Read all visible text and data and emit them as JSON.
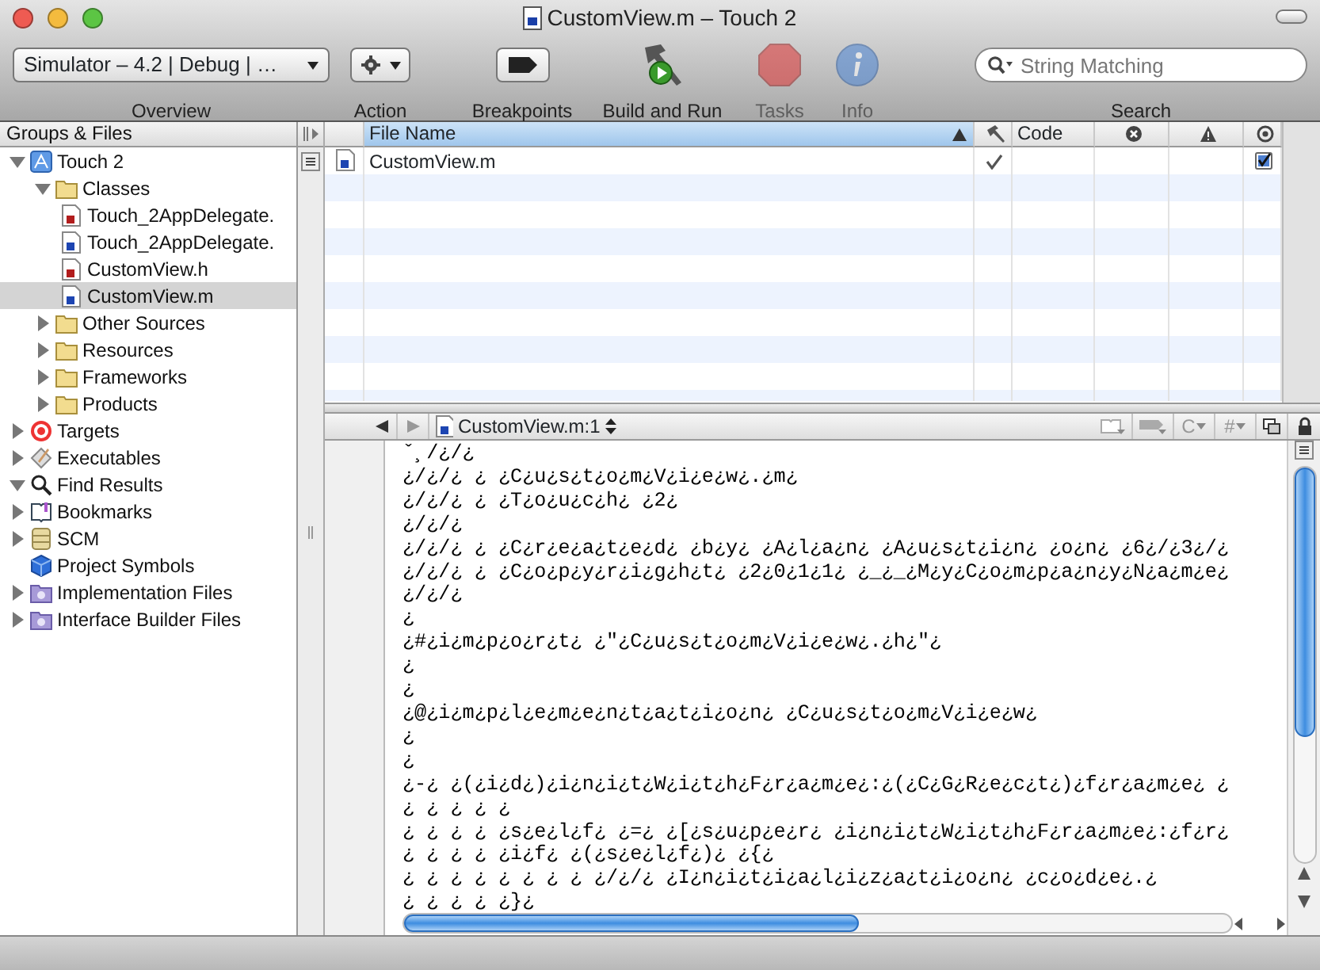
{
  "window": {
    "title": "CustomView.m – Touch 2"
  },
  "toolbar": {
    "items": [
      {
        "kind": "popup",
        "value": "Simulator – 4.2 | Debug | …",
        "label": "Overview",
        "disabled": false
      },
      {
        "kind": "action",
        "label": "Action",
        "disabled": false
      },
      {
        "kind": "breakpoints",
        "label": "Breakpoints",
        "disabled": false
      },
      {
        "kind": "build",
        "label": "Build and Run",
        "disabled": false
      },
      {
        "kind": "tasks",
        "label": "Tasks",
        "disabled": true
      },
      {
        "kind": "info",
        "label": "Info",
        "disabled": true
      }
    ],
    "search": {
      "placeholder": "String Matching",
      "label": "Search"
    }
  },
  "sidebar": {
    "title": "Groups & Files",
    "items": [
      {
        "kind": "project",
        "label": "Touch 2",
        "expanded": true,
        "selected": false,
        "children": [
          {
            "kind": "folder",
            "label": "Classes",
            "expanded": true,
            "selected": false,
            "children": [
              {
                "kind": "header",
                "label": "Touch_2AppDelegate.",
                "selected": false
              },
              {
                "kind": "source",
                "label": "Touch_2AppDelegate.",
                "selected": false
              },
              {
                "kind": "header",
                "label": "CustomView.h",
                "selected": false
              },
              {
                "kind": "source",
                "label": "CustomView.m",
                "selected": true
              }
            ]
          },
          {
            "kind": "folder",
            "label": "Other Sources",
            "expanded": false,
            "selected": false
          },
          {
            "kind": "folder",
            "label": "Resources",
            "expanded": false,
            "selected": false
          },
          {
            "kind": "folder",
            "label": "Frameworks",
            "expanded": false,
            "selected": false
          },
          {
            "kind": "folder",
            "label": "Products",
            "expanded": false,
            "selected": false
          }
        ]
      },
      {
        "kind": "target",
        "label": "Targets",
        "expanded": false,
        "selected": false
      },
      {
        "kind": "executables",
        "label": "Executables",
        "expanded": false,
        "selected": false
      },
      {
        "kind": "find",
        "label": "Find Results",
        "expanded": true,
        "selected": false
      },
      {
        "kind": "bookmarks",
        "label": "Bookmarks",
        "expanded": false,
        "selected": false
      },
      {
        "kind": "scm",
        "label": "SCM",
        "expanded": false,
        "selected": false
      },
      {
        "kind": "symbols",
        "label": "Project Symbols",
        "selected": false
      },
      {
        "kind": "smart",
        "label": "Implementation Files",
        "expanded": false,
        "selected": false
      },
      {
        "kind": "smart",
        "label": "Interface Builder Files",
        "expanded": false,
        "selected": false
      }
    ]
  },
  "file_table": {
    "columns": [
      {
        "kind": "name",
        "label": "File Name",
        "sorted": true
      },
      {
        "kind": "build",
        "sorted": false
      },
      {
        "kind": "code",
        "label": "Code",
        "sorted": false
      },
      {
        "kind": "errors",
        "sorted": false
      },
      {
        "kind": "warnings",
        "sorted": false
      },
      {
        "kind": "target",
        "sorted": false
      }
    ],
    "rows": [
      {
        "name": "CustomView.m",
        "built": true,
        "in_target": true
      }
    ]
  },
  "editor": {
    "file_popup": "CustomView.m:1",
    "nav_symbols": [
      "C",
      "#"
    ],
    "lines": [
      "ˇ¸/¿/¿",
      "¿/¿/¿ ¿ ¿C¿u¿s¿t¿o¿m¿V¿i¿e¿w¿.¿m¿",
      "¿/¿/¿ ¿ ¿T¿o¿u¿c¿h¿ ¿2¿",
      "¿/¿/¿",
      "¿/¿/¿ ¿ ¿C¿r¿e¿a¿t¿e¿d¿ ¿b¿y¿ ¿A¿l¿a¿n¿ ¿A¿u¿s¿t¿i¿n¿ ¿o¿n¿ ¿6¿/¿3¿/¿",
      "¿/¿/¿ ¿ ¿C¿o¿p¿y¿r¿i¿g¿h¿t¿ ¿2¿0¿1¿1¿ ¿_¿_¿M¿y¿C¿o¿m¿p¿a¿n¿y¿N¿a¿m¿e¿",
      "¿/¿/¿",
      "¿",
      "¿#¿i¿m¿p¿o¿r¿t¿ ¿\"¿C¿u¿s¿t¿o¿m¿V¿i¿e¿w¿.¿h¿\"¿",
      "¿",
      "¿",
      "¿@¿i¿m¿p¿l¿e¿m¿e¿n¿t¿a¿t¿i¿o¿n¿ ¿C¿u¿s¿t¿o¿m¿V¿i¿e¿w¿",
      "¿",
      "¿",
      "¿-¿ ¿(¿i¿d¿)¿i¿n¿i¿t¿W¿i¿t¿h¿F¿r¿a¿m¿e¿:¿(¿C¿G¿R¿e¿c¿t¿)¿f¿r¿a¿m¿e¿ ¿",
      "¿ ¿ ¿ ¿ ¿",
      "¿ ¿ ¿ ¿ ¿s¿e¿l¿f¿ ¿=¿ ¿[¿s¿u¿p¿e¿r¿ ¿i¿n¿i¿t¿W¿i¿t¿h¿F¿r¿a¿m¿e¿:¿f¿r¿",
      "¿ ¿ ¿ ¿ ¿i¿f¿ ¿(¿s¿e¿l¿f¿)¿ ¿{¿",
      "¿ ¿ ¿ ¿ ¿ ¿ ¿ ¿ ¿/¿/¿ ¿I¿n¿i¿t¿i¿a¿l¿i¿z¿a¿t¿i¿o¿n¿ ¿c¿o¿d¿e¿.¿",
      "¿ ¿ ¿ ¿ ¿}¿"
    ]
  }
}
